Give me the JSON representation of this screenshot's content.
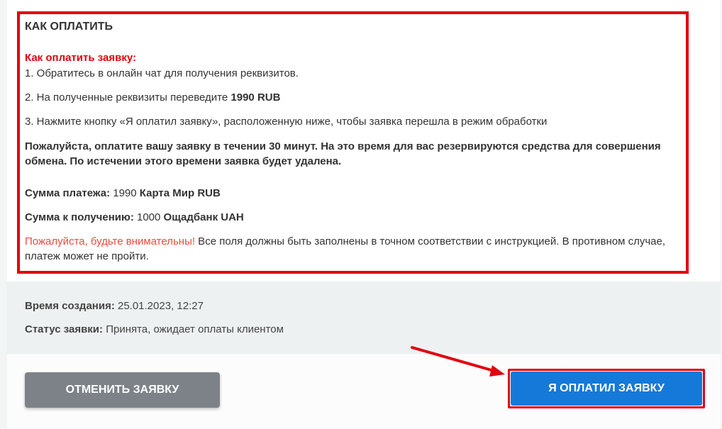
{
  "howto": {
    "title": "КАК ОПЛАТИТЬ",
    "subtitle": "Как оплатить заявку:",
    "step1": "1. Обратитесь в онлайн чат для получения реквизитов.",
    "step2_text": "2. На полученные реквизиты переведите ",
    "step2_amount": "1990 RUB",
    "step3": "3. Нажмите кнопку «Я оплатил заявку», расположенную ниже, чтобы заявка перешла в режим обработки",
    "warning": "Пожалуйста, оплатите вашу заявку в течении 30 минут. На это время для вас резервируются средства для совершения обмена. По истечении этого времени заявка будет удалена.",
    "send_label": "Сумма платежа:",
    "send_amount": " 1990 ",
    "send_method": "Карта Мир RUB",
    "receive_label": "Сумма к получению:",
    "receive_amount": " 1000 ",
    "receive_method": "Ощадбанк UAH",
    "attention_red": "Пожалуйста, будьте внимательны!",
    "attention_text": " Все поля должны быть заполнены в точном соответствии с инструкцией. В противном случае, платеж может не пройти."
  },
  "info": {
    "created_label": "Время создания:",
    "created_value": " 25.01.2023, 12:27",
    "status_label": "Статус заявки:",
    "status_value": " Принята, ожидает оплаты клиентом"
  },
  "actions": {
    "cancel_label": "ОТМЕНИТЬ ЗАЯВКУ",
    "paid_label": "Я ОПЛАТИЛ ЗАЯВКУ"
  },
  "colors": {
    "highlight": "#e2000f",
    "primary": "#1479d9",
    "secondary": "#7d8288"
  }
}
